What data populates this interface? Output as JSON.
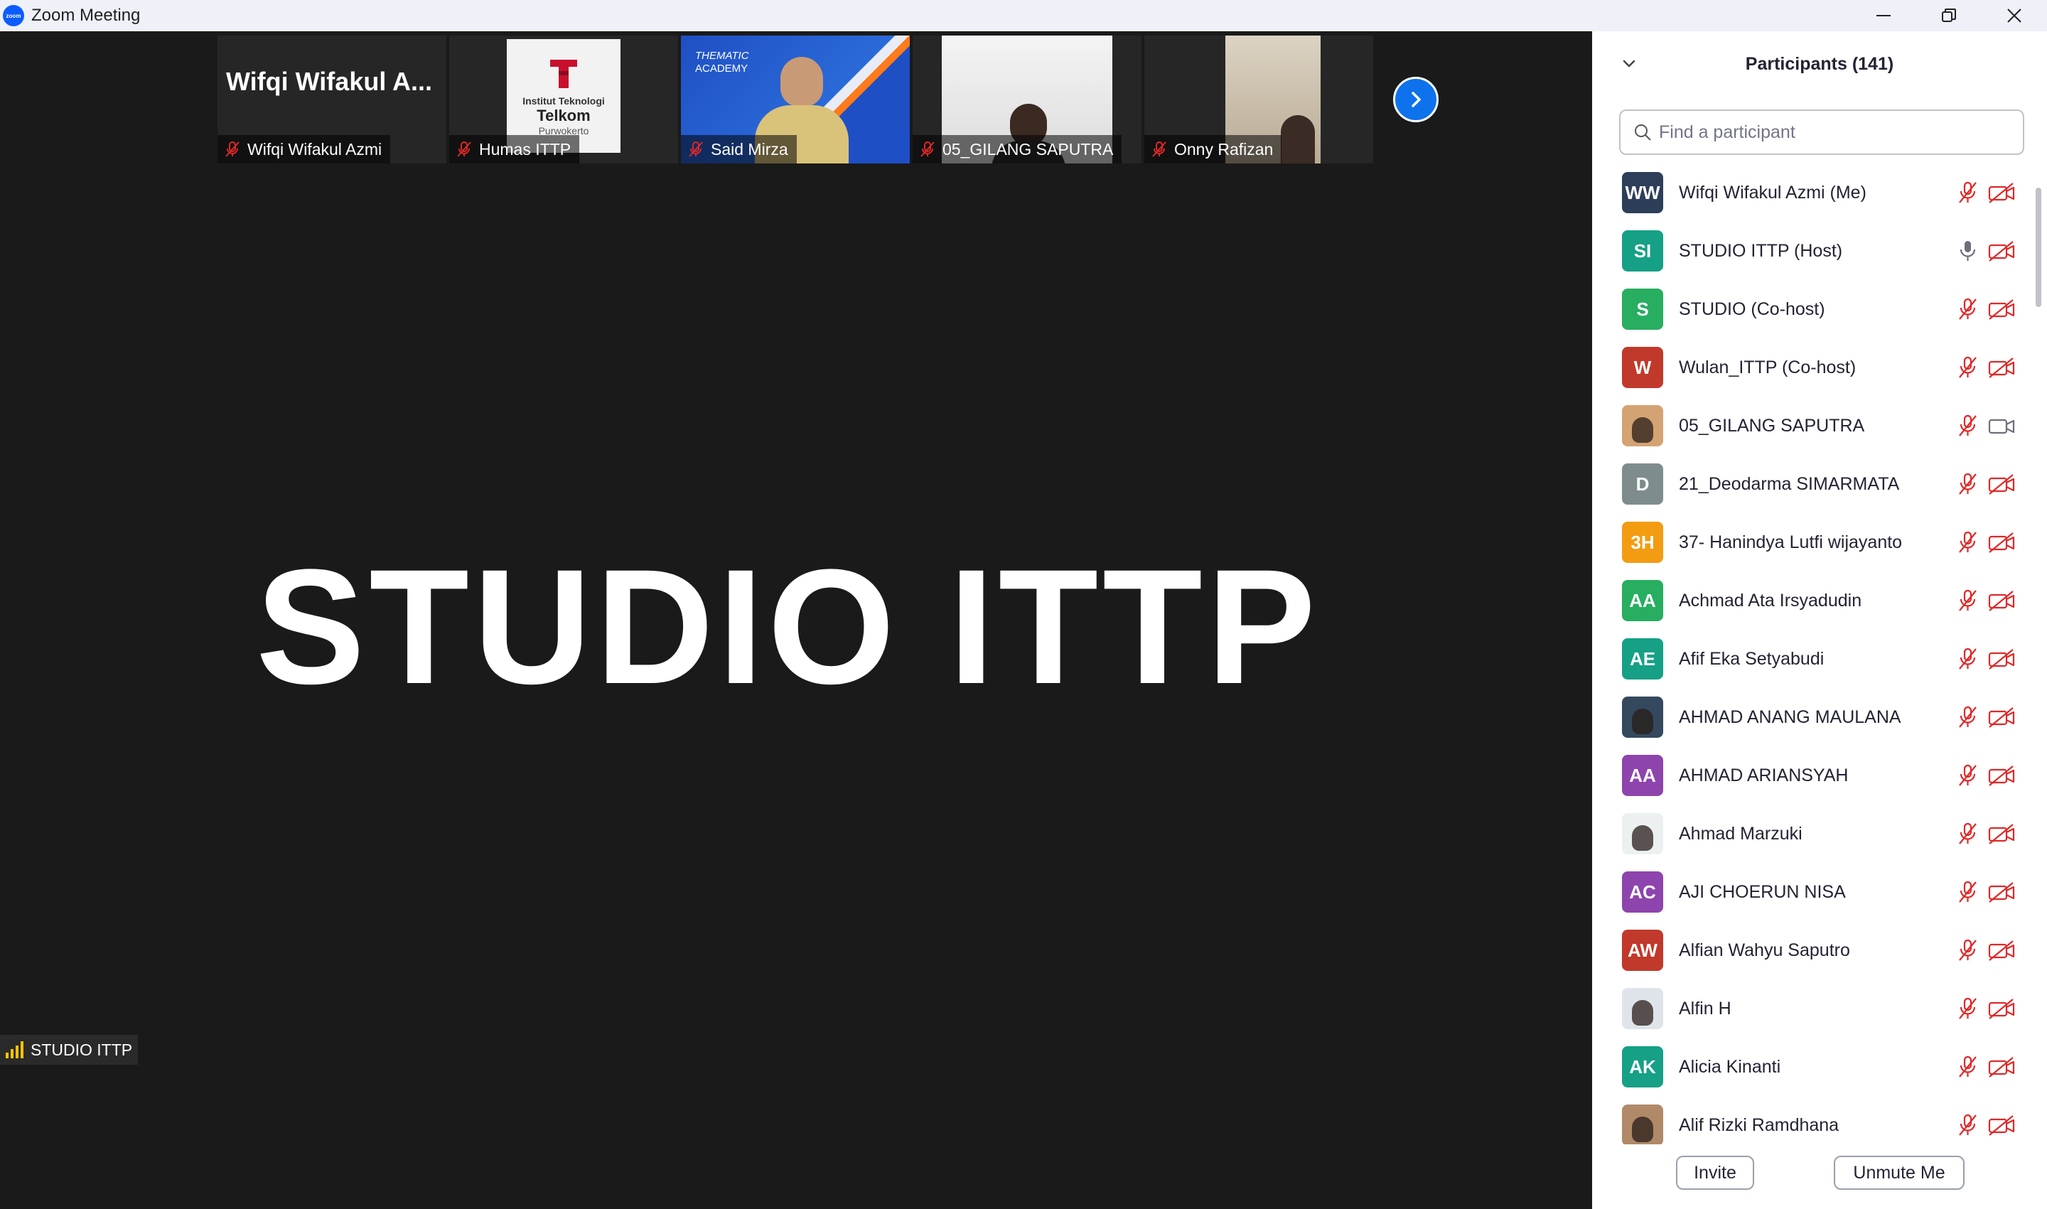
{
  "window": {
    "title": "Zoom Meeting",
    "app_logo_text": "zoom"
  },
  "gallery": {
    "tiles": [
      {
        "name": "Wifqi Wifakul Azmi",
        "big_name": "Wifqi Wifakul A..."
      },
      {
        "name": "Humas ITTP",
        "logo_line1": "Institut Teknologi",
        "logo_line2": "Telkom",
        "logo_line3": "Purwokerto"
      },
      {
        "name": "Said Mirza",
        "bg_line1": "THEMATIC",
        "bg_line2": "ACADEMY"
      },
      {
        "name": "05_GILANG SAPUTRA"
      },
      {
        "name": "Onny Rafizan"
      }
    ]
  },
  "active_speaker": {
    "display_name": "STUDIO ITTP",
    "badge_label": "STUDIO ITTP"
  },
  "panel": {
    "title": "Participants (141)",
    "search_placeholder": "Find a participant",
    "participants": [
      {
        "name": "Wifqi Wifakul Azmi (Me)",
        "initials": "WW",
        "color": "#2d3e58",
        "mic": "muted",
        "cam": "off"
      },
      {
        "name": "STUDIO ITTP (Host)",
        "initials": "SI",
        "color": "#16a085",
        "mic": "on",
        "cam": "off"
      },
      {
        "name": "STUDIO (Co-host)",
        "initials": "S",
        "color": "#27ae60",
        "mic": "muted",
        "cam": "off"
      },
      {
        "name": "Wulan_ITTP (Co-host)",
        "initials": "W",
        "color": "#c0392b",
        "mic": "muted",
        "cam": "off"
      },
      {
        "name": "05_GILANG SAPUTRA",
        "initials": "",
        "color": "#d4a373",
        "mic": "muted",
        "cam": "on"
      },
      {
        "name": "21_Deodarma SIMARMATA",
        "initials": "D",
        "color": "#7f8c8d",
        "mic": "muted",
        "cam": "off"
      },
      {
        "name": "37- Hanindya Lutfi wijayanto",
        "initials": "3H",
        "color": "#f39c12",
        "mic": "muted",
        "cam": "off"
      },
      {
        "name": "Achmad Ata Irsyadudin",
        "initials": "AA",
        "color": "#27ae60",
        "mic": "muted",
        "cam": "off"
      },
      {
        "name": "Afif Eka Setyabudi",
        "initials": "AE",
        "color": "#16a085",
        "mic": "muted",
        "cam": "off"
      },
      {
        "name": "AHMAD ANANG MAULANA",
        "initials": "",
        "color": "#34495e",
        "mic": "muted",
        "cam": "off"
      },
      {
        "name": "AHMAD ARIANSYAH",
        "initials": "AA",
        "color": "#8e44ad",
        "mic": "muted",
        "cam": "off"
      },
      {
        "name": "Ahmad Marzuki",
        "initials": "",
        "color": "#ecf0f1",
        "mic": "muted",
        "cam": "off"
      },
      {
        "name": "AJI CHOERUN NISA",
        "initials": "AC",
        "color": "#8e44ad",
        "mic": "muted",
        "cam": "off"
      },
      {
        "name": "Alfian Wahyu Saputro",
        "initials": "AW",
        "color": "#c0392b",
        "mic": "muted",
        "cam": "off"
      },
      {
        "name": "Alfin H",
        "initials": "",
        "color": "#dfe4ea",
        "mic": "muted",
        "cam": "off"
      },
      {
        "name": "Alicia Kinanti",
        "initials": "AK",
        "color": "#16a085",
        "mic": "muted",
        "cam": "off"
      },
      {
        "name": "Alif Rizki Ramdhana",
        "initials": "",
        "color": "#b08968",
        "mic": "muted",
        "cam": "off"
      }
    ],
    "invite_label": "Invite",
    "unmute_label": "Unmute Me"
  }
}
